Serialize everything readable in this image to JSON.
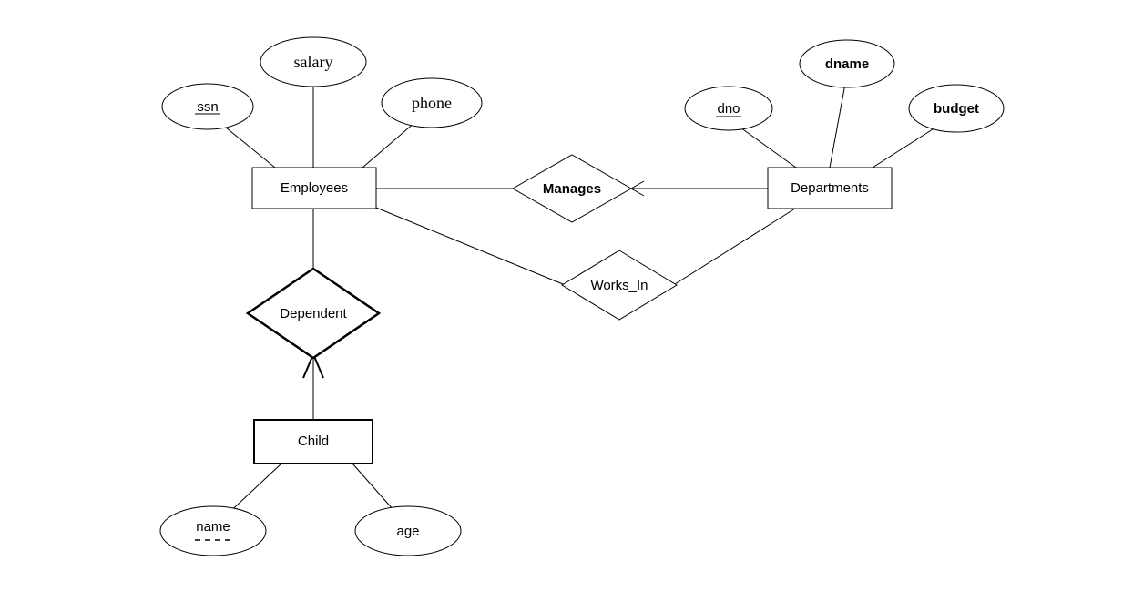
{
  "diagram": {
    "type": "ER",
    "entities": {
      "employees": {
        "label": "Employees",
        "attributes": [
          "ssn",
          "salary",
          "phone"
        ]
      },
      "departments": {
        "label": "Departments",
        "attributes": [
          "dno",
          "dname",
          "budget"
        ]
      },
      "child": {
        "label": "Child",
        "weak": true,
        "attributes": [
          "name",
          "age"
        ]
      }
    },
    "relationships": {
      "manages": {
        "label": "Manages",
        "between": [
          "employees",
          "departments"
        ]
      },
      "works_in": {
        "label": "Works_In",
        "between": [
          "employees",
          "departments"
        ]
      },
      "dependent": {
        "label": "Dependent",
        "identifying": true,
        "between": [
          "employees",
          "child"
        ]
      }
    },
    "attributes": {
      "ssn": {
        "label": "ssn",
        "key": true
      },
      "salary": {
        "label": "salary"
      },
      "phone": {
        "label": "phone"
      },
      "dno": {
        "label": "dno",
        "key": true
      },
      "dname": {
        "label": "dname"
      },
      "budget": {
        "label": "budget"
      },
      "name": {
        "label": "name",
        "partialKey": true
      },
      "age": {
        "label": "age"
      }
    }
  }
}
